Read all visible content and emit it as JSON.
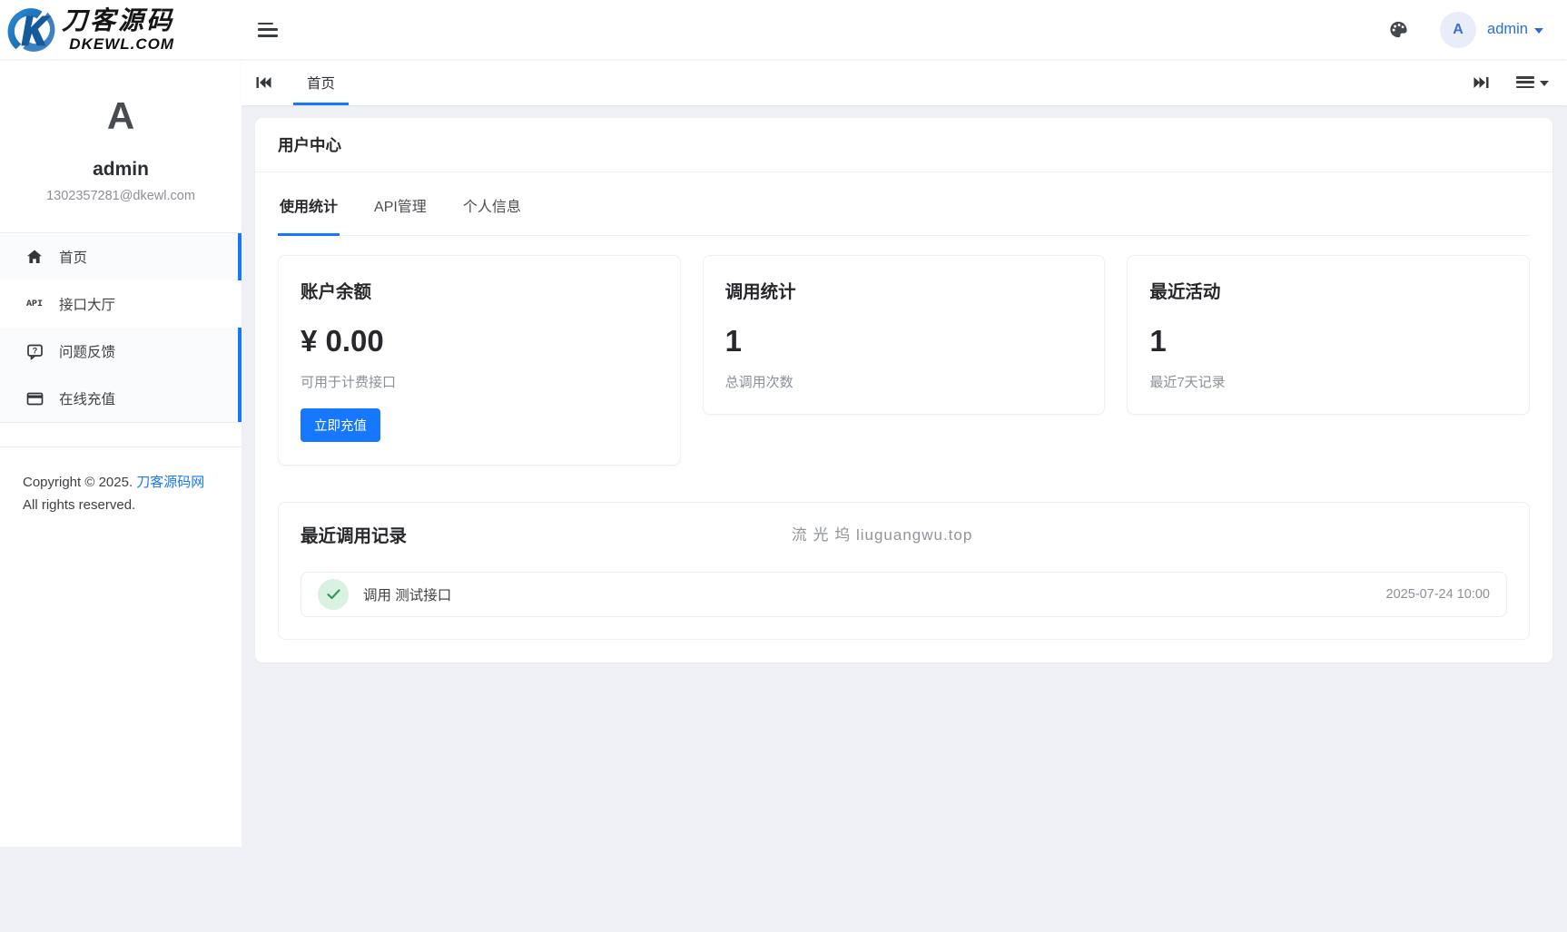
{
  "header": {
    "logo": {
      "title": "刀客源码",
      "subtitle": "DKEWL.COM"
    },
    "user": {
      "initial": "A",
      "name": "admin"
    }
  },
  "tabbar": {
    "home_tab": "首页"
  },
  "sidebar": {
    "profile": {
      "initial": "A",
      "name": "admin",
      "email": "1302357281@dkewl.com"
    },
    "menu": [
      {
        "label": "首页"
      },
      {
        "label": "接口大厅",
        "badge": "API"
      },
      {
        "label": "问题反馈"
      },
      {
        "label": "在线充值"
      }
    ],
    "footer": {
      "copyright_prefix": "Copyright © 2025. ",
      "copyright_link": "刀客源码网",
      "rights": "All rights reserved."
    }
  },
  "main": {
    "panel_title": "用户中心",
    "tabs": [
      {
        "label": "使用统计"
      },
      {
        "label": "API管理"
      },
      {
        "label": "个人信息"
      }
    ],
    "stats": [
      {
        "title": "账户余额",
        "value": "¥ 0.00",
        "caption": "可用于计费接口",
        "button": "立即充值"
      },
      {
        "title": "调用统计",
        "value": "1",
        "caption": "总调用次数"
      },
      {
        "title": "最近活动",
        "value": "1",
        "caption": "最近7天记录"
      }
    ],
    "recent": {
      "title": "最近调用记录",
      "watermark": "流 光 坞 liuguangwu.top",
      "items": [
        {
          "text": "调用 测试接口",
          "time": "2025-07-24 10:00"
        }
      ]
    }
  },
  "colors": {
    "accent": "#1677ff",
    "success_bg": "#d9f1e1",
    "success_fg": "#35985d"
  }
}
